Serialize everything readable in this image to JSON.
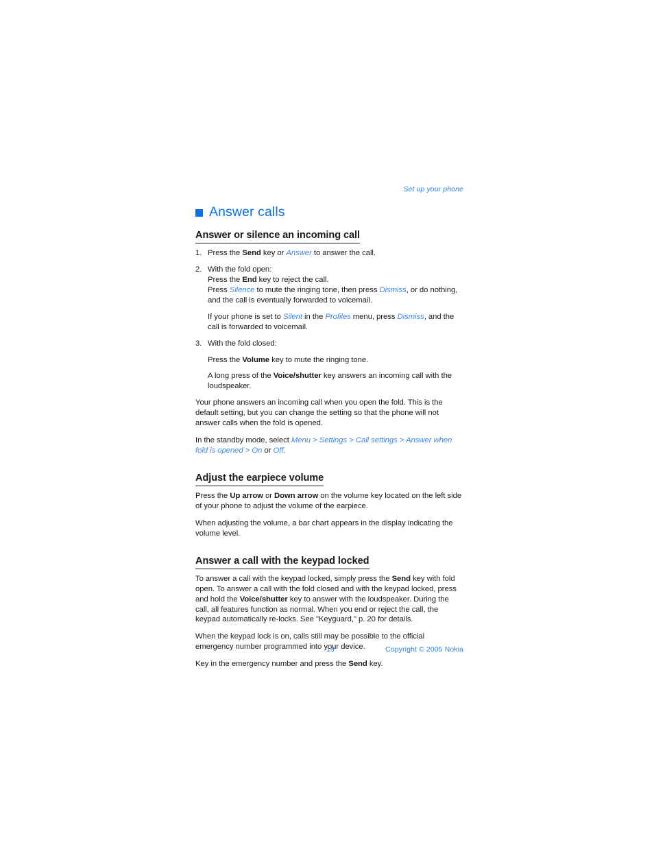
{
  "runhead": "Set up your phone",
  "chapter": {
    "bullet_color": "#0a72e8",
    "title": "Answer calls"
  },
  "colors": {
    "accent_blue": "#0a72e8",
    "link_blue": "#3f86e4",
    "footer_blue": "#2f7fe0",
    "body_black": "#1a1a1a"
  },
  "sections": [
    {
      "heading": "Answer or silence an incoming call",
      "steps": [
        {
          "num": "1.",
          "lines": [
            [
              {
                "t": "Press the ",
                "s": "n"
              },
              {
                "t": "Send",
                "s": "b"
              },
              {
                "t": " key or ",
                "s": "n"
              },
              {
                "t": "Answer",
                "s": "i"
              },
              {
                "t": " to answer the call.",
                "s": "n"
              }
            ]
          ]
        },
        {
          "num": "2.",
          "lines": [
            [
              {
                "t": "With the fold open:",
                "s": "n"
              }
            ],
            [
              {
                "t": "Press the ",
                "s": "n"
              },
              {
                "t": "End",
                "s": "b"
              },
              {
                "t": " key to reject the call.",
                "s": "n"
              }
            ],
            [
              {
                "t": "Press ",
                "s": "n"
              },
              {
                "t": "Silence",
                "s": "i"
              },
              {
                "t": " to mute the ringing tone, then press ",
                "s": "n"
              },
              {
                "t": "Dismiss",
                "s": "i"
              },
              {
                "t": ", or do nothing, and the call is eventually forwarded to voicemail.",
                "s": "n"
              }
            ]
          ],
          "blocks": [
            [
              {
                "t": "If your phone is set to ",
                "s": "n"
              },
              {
                "t": "Silent",
                "s": "i"
              },
              {
                "t": " in the ",
                "s": "n"
              },
              {
                "t": "Profiles",
                "s": "i"
              },
              {
                "t": " menu, press ",
                "s": "n"
              },
              {
                "t": "Dismiss",
                "s": "i"
              },
              {
                "t": ", and the call is forwarded to voicemail.",
                "s": "n"
              }
            ]
          ]
        },
        {
          "num": "3.",
          "lines": [
            [
              {
                "t": "With the fold closed:",
                "s": "n"
              }
            ]
          ],
          "blocks": [
            [
              {
                "t": "Press the ",
                "s": "n"
              },
              {
                "t": "Volume",
                "s": "b"
              },
              {
                "t": " key to mute the ringing tone.",
                "s": "n"
              }
            ],
            [
              {
                "t": "A long press of the ",
                "s": "n"
              },
              {
                "t": "Voice/shutter",
                "s": "b"
              },
              {
                "t": " key answers an incoming call with the loudspeaker.",
                "s": "n"
              }
            ]
          ]
        }
      ],
      "paragraphs": [
        [
          {
            "t": "Your phone answers an incoming call when you open the fold. This is the default setting, but you can change the setting so that the phone will not answer calls when the fold is opened.",
            "s": "n"
          }
        ],
        [
          {
            "t": "In the standby mode, select ",
            "s": "n"
          },
          {
            "t": "Menu",
            "s": "i"
          },
          {
            "t": " > ",
            "s": "sep"
          },
          {
            "t": "Settings",
            "s": "i"
          },
          {
            "t": " > ",
            "s": "sep"
          },
          {
            "t": "Call settings",
            "s": "i"
          },
          {
            "t": " > ",
            "s": "sep"
          },
          {
            "t": "Answer when fold is opened",
            "s": "i"
          },
          {
            "t": " > ",
            "s": "sep"
          },
          {
            "t": "On",
            "s": "i"
          },
          {
            "t": " or ",
            "s": "n"
          },
          {
            "t": "Off",
            "s": "i"
          },
          {
            "t": ".",
            "s": "n"
          }
        ]
      ]
    },
    {
      "heading": "Adjust the earpiece volume",
      "steps": [],
      "paragraphs": [
        [
          {
            "t": "Press the ",
            "s": "n"
          },
          {
            "t": "Up arrow",
            "s": "b"
          },
          {
            "t": " or ",
            "s": "n"
          },
          {
            "t": "Down arrow",
            "s": "b"
          },
          {
            "t": " on the volume key located on the left side of your phone to adjust the volume of the earpiece.",
            "s": "n"
          }
        ],
        [
          {
            "t": "When adjusting the volume, a bar chart appears in the display indicating the volume level.",
            "s": "n"
          }
        ]
      ]
    },
    {
      "heading": "Answer a call with the keypad locked",
      "steps": [],
      "paragraphs": [
        [
          {
            "t": "To answer a call with the keypad locked, simply press the ",
            "s": "n"
          },
          {
            "t": "Send",
            "s": "b"
          },
          {
            "t": " key with fold open. To answer a call with the fold closed and with the keypad locked, press and hold the ",
            "s": "n"
          },
          {
            "t": "Voice/shutter",
            "s": "b"
          },
          {
            "t": " key to answer with the loudspeaker. During the call, all features function as normal. When you end or reject the call, the keypad automatically re-locks. See \"Keyguard,\" p. 20 for details.",
            "s": "n"
          }
        ],
        [
          {
            "t": "When the keypad lock is on, calls still may be possible to the official emergency number programmed into your device.",
            "s": "n"
          }
        ],
        [
          {
            "t": "Key in the emergency number and press the ",
            "s": "n"
          },
          {
            "t": "Send",
            "s": "b"
          },
          {
            "t": " key.",
            "s": "n"
          }
        ]
      ]
    }
  ],
  "footer": {
    "page_number": "19",
    "copyright": "Copyright © 2005 Nokia"
  }
}
